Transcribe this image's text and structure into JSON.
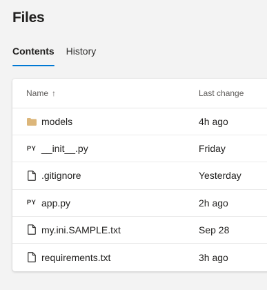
{
  "page": {
    "title": "Files"
  },
  "tabs": [
    {
      "label": "Contents",
      "active": true
    },
    {
      "label": "History",
      "active": false
    }
  ],
  "table": {
    "columns": {
      "name": "Name",
      "last_change": "Last change"
    },
    "sort_icon": "arrow-up-icon",
    "rows": [
      {
        "name": "models",
        "last_change": "4h ago",
        "icon": "folder-icon"
      },
      {
        "name": "__init__.py",
        "last_change": "Friday",
        "icon": "python-file-icon",
        "icon_text": "PY"
      },
      {
        "name": ".gitignore",
        "last_change": "Yesterday",
        "icon": "file-icon"
      },
      {
        "name": "app.py",
        "last_change": "2h ago",
        "icon": "python-file-icon",
        "icon_text": "PY"
      },
      {
        "name": "my.ini.SAMPLE.txt",
        "last_change": "Sep 28",
        "icon": "file-icon"
      },
      {
        "name": "requirements.txt",
        "last_change": "3h ago",
        "icon": "file-icon"
      }
    ]
  },
  "colors": {
    "accent": "#0078d4",
    "folder": "#dcb67a",
    "background": "#f3f3f3"
  }
}
